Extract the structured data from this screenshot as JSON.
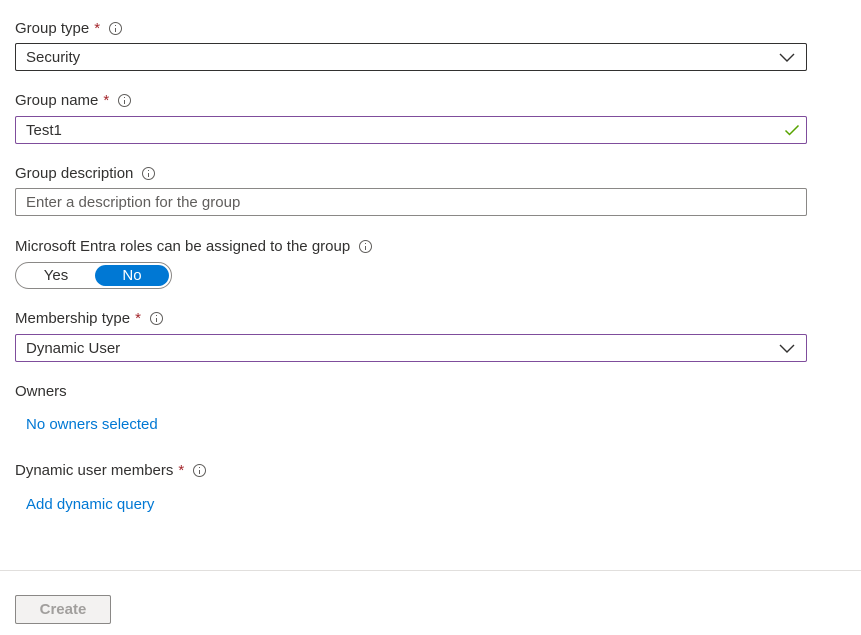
{
  "group_type": {
    "label": "Group type",
    "required_mark": "*",
    "value": "Security"
  },
  "group_name": {
    "label": "Group name",
    "required_mark": "*",
    "value": "Test1"
  },
  "group_description": {
    "label": "Group description",
    "placeholder": "Enter a description for the group"
  },
  "entra_roles": {
    "label": "Microsoft Entra roles can be assigned to the group",
    "yes_label": "Yes",
    "no_label": "No",
    "selected": "No"
  },
  "membership_type": {
    "label": "Membership type",
    "required_mark": "*",
    "value": "Dynamic User"
  },
  "owners": {
    "label": "Owners",
    "link": "No owners selected"
  },
  "dynamic_members": {
    "label": "Dynamic user members",
    "required_mark": "*",
    "link": "Add dynamic query"
  },
  "footer": {
    "create_label": "Create"
  },
  "colors": {
    "accent": "#0078d4",
    "required": "#a4262c",
    "valid_check": "#57a300",
    "focus_border": "#7f4d9c"
  },
  "icons": [
    "info-icon",
    "chevron-down-icon",
    "checkmark-icon"
  ]
}
